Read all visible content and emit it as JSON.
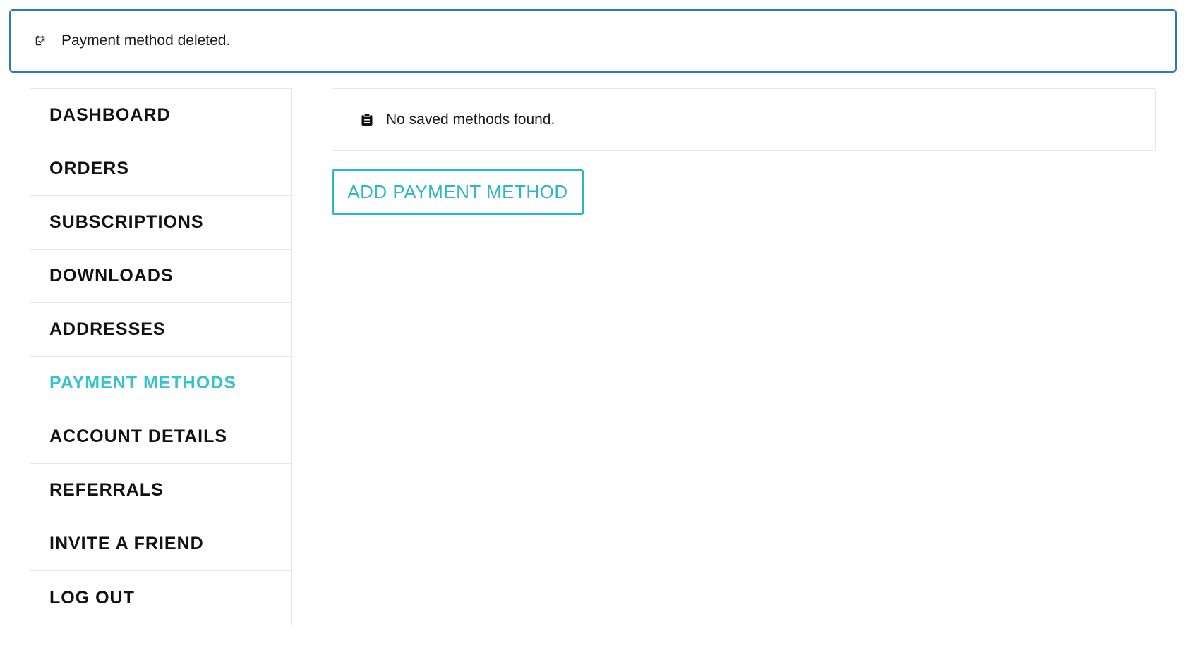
{
  "notice": {
    "icon": "calendar-check-icon",
    "message": "Payment method deleted.",
    "border_color": "#2f74c8"
  },
  "sidebar": {
    "active_color": "#36c3cc",
    "items": [
      {
        "label": "DASHBOARD",
        "active": false
      },
      {
        "label": "ORDERS",
        "active": false
      },
      {
        "label": "SUBSCRIPTIONS",
        "active": false
      },
      {
        "label": "DOWNLOADS",
        "active": false
      },
      {
        "label": "ADDRESSES",
        "active": false
      },
      {
        "label": "PAYMENT METHODS",
        "active": true
      },
      {
        "label": "ACCOUNT DETAILS",
        "active": false
      },
      {
        "label": "REFERRALS",
        "active": false
      },
      {
        "label": "INVITE A FRIEND",
        "active": false
      },
      {
        "label": "LOG OUT",
        "active": false
      }
    ]
  },
  "main": {
    "info": {
      "icon": "clipboard-icon",
      "message": "No saved methods found."
    },
    "add_button": {
      "label": "ADD PAYMENT METHOD",
      "color": "#2bb8c6"
    }
  }
}
